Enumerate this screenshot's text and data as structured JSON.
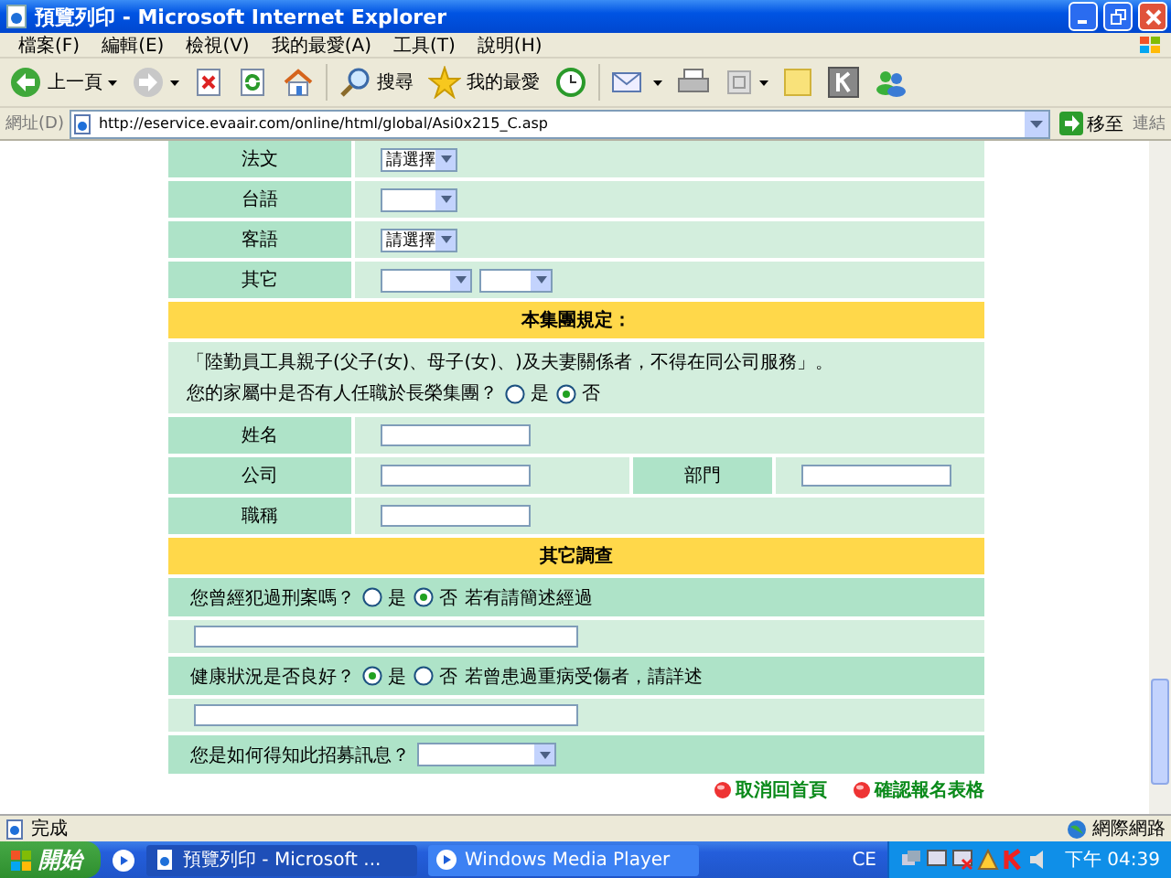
{
  "window": {
    "title": "預覽列印 - Microsoft Internet Explorer"
  },
  "menu": [
    "檔案(F)",
    "編輯(E)",
    "檢視(V)",
    "我的最愛(A)",
    "工具(T)",
    "說明(H)"
  ],
  "toolbar": {
    "back": "上一頁",
    "search": "搜尋",
    "favorites": "我的最愛"
  },
  "address": {
    "label": "網址(D)",
    "url": "http://eservice.evaair.com/online/html/global/Asi0x215_C.asp",
    "go": "移至",
    "links": "連結"
  },
  "languages": [
    {
      "label": "法文",
      "kind": "select",
      "value": "請選擇"
    },
    {
      "label": "台語",
      "kind": "select"
    },
    {
      "label": "客語",
      "kind": "select",
      "value": "請選擇"
    },
    {
      "label": "其它",
      "kind": "double-select"
    }
  ],
  "rules": {
    "heading": "本集團規定：",
    "notice": "「陸勤員工具親子(父子(女)、母子(女)、)及夫妻關係者，不得在同公司服務」。",
    "question": "您的家屬中是否有人任職於長榮集團？",
    "options": [
      {
        "label": "是",
        "selected": false
      },
      {
        "label": "否",
        "selected": true
      }
    ]
  },
  "relative_fields": [
    [
      {
        "label": "姓名"
      }
    ],
    [
      {
        "label": "公司"
      },
      {
        "label": "部門"
      }
    ],
    [
      {
        "label": "職稱"
      }
    ]
  ],
  "survey": {
    "heading": "其它調查",
    "questions": [
      {
        "kind": "radio-text",
        "question": "您曾經犯過刑案嗎？",
        "options": [
          {
            "label": "是",
            "selected": false
          },
          {
            "label": "否",
            "selected": true
          }
        ],
        "note": "若有請簡述經過"
      },
      {
        "kind": "radio-text",
        "question": "健康狀況是否良好？",
        "options": [
          {
            "label": "是",
            "selected": true
          },
          {
            "label": "否",
            "selected": false
          }
        ],
        "note": "若曾患過重病受傷者，請詳述"
      },
      {
        "kind": "select",
        "question": "您是如何得知此招募訊息？"
      }
    ]
  },
  "links": [
    "取消回首頁",
    "確認報名表格"
  ],
  "status": {
    "text": "完成",
    "zone": "網際網路"
  },
  "taskbar": {
    "start": "開始",
    "tasks": [
      {
        "label": "預覽列印 - Microsoft ...",
        "selected": true
      },
      {
        "label": "Windows Media Player",
        "selected": false
      }
    ],
    "lang": "CE",
    "clock": "下午 04:39"
  }
}
